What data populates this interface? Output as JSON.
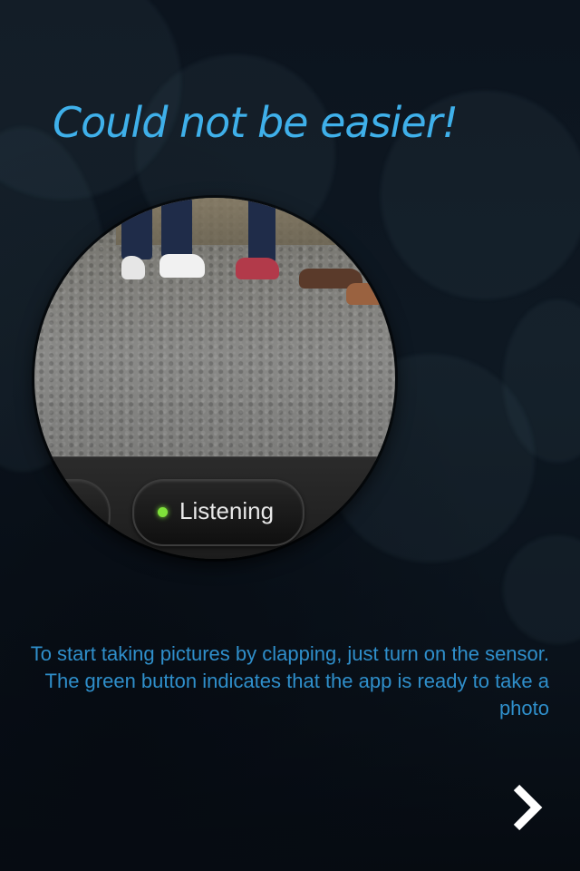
{
  "title": "Could not be easier!",
  "preview": {
    "status_button_label": "Listening",
    "status_indicator_color": "#7fe13a"
  },
  "description": "To start taking pictures by clapping, just turn on the sensor. The green button indicates that the app is ready to take a photo",
  "navigation": {
    "next_icon": "chevron-right-icon"
  },
  "colors": {
    "accent": "#3fb0ea",
    "text_blue": "#2f8fcb",
    "background": "#0b121b"
  }
}
